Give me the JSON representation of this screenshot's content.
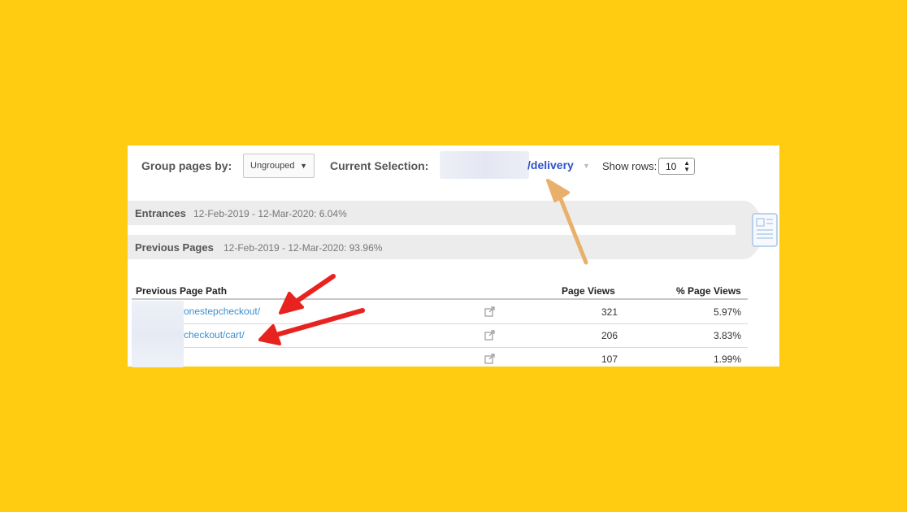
{
  "controls": {
    "group_pages_label": "Group pages by:",
    "group_pages_value": "Ungrouped",
    "current_selection_label": "Current Selection:",
    "current_selection_value": "/delivery",
    "show_rows_label": "Show rows:",
    "show_rows_value": "10"
  },
  "flow": {
    "entrances_label": "Entrances",
    "entrances_stat": "12-Feb-2019 - 12-Mar-2020: 6.04%",
    "previous_pages_label": "Previous Pages",
    "previous_pages_stat": "12-Feb-2019 - 12-Mar-2020: 93.96%"
  },
  "table": {
    "headers": [
      "Previous Page Path",
      "Page Views",
      "% Page Views"
    ],
    "rows": [
      {
        "path": "onestepcheckout/",
        "views": "321",
        "pct": "5.97%"
      },
      {
        "path": "checkout/cart/",
        "views": "206",
        "pct": "3.83%"
      },
      {
        "path": "",
        "views": "107",
        "pct": "1.99%"
      }
    ]
  },
  "colors": {
    "background": "#FFCC11",
    "link": "#3a8fd1",
    "selection": "#2d52c7",
    "red_arrow": "#e8231f",
    "tan_arrow": "#e8b06a"
  }
}
